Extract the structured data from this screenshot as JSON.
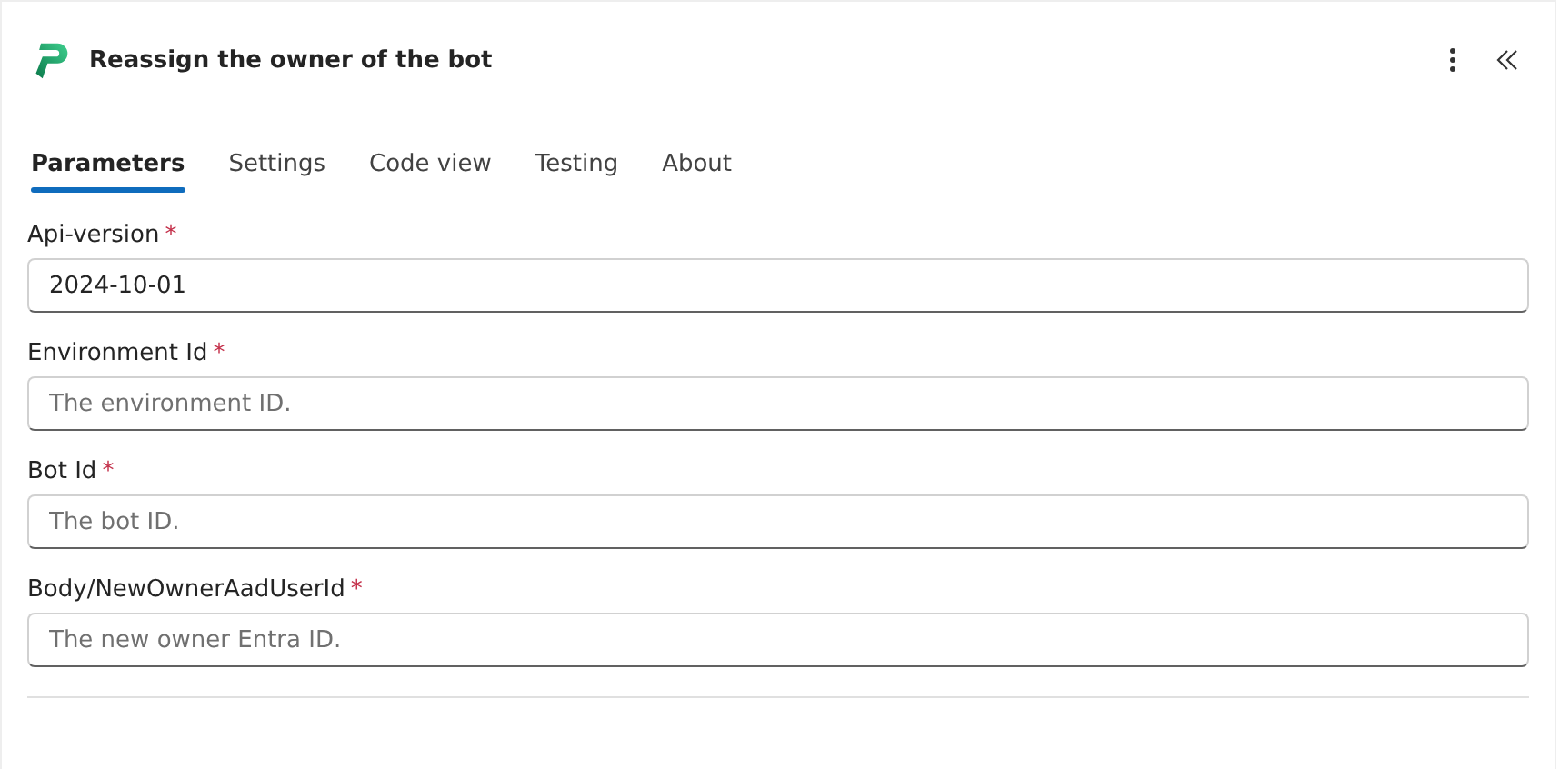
{
  "header": {
    "title": "Reassign the owner of the bot"
  },
  "tabs": [
    {
      "label": "Parameters",
      "selected": true
    },
    {
      "label": "Settings",
      "selected": false
    },
    {
      "label": "Code view",
      "selected": false
    },
    {
      "label": "Testing",
      "selected": false
    },
    {
      "label": "About",
      "selected": false
    }
  ],
  "fields": [
    {
      "label": "Api-version",
      "required_mark": "*",
      "value": "2024-10-01"
    },
    {
      "label": "Environment Id",
      "required_mark": "*",
      "placeholder": "The environment ID."
    },
    {
      "label": "Bot Id",
      "required_mark": "*",
      "placeholder": "The bot ID."
    },
    {
      "label": "Body/NewOwnerAadUserId",
      "required_mark": "*",
      "placeholder": "The new owner Entra ID."
    }
  ]
}
